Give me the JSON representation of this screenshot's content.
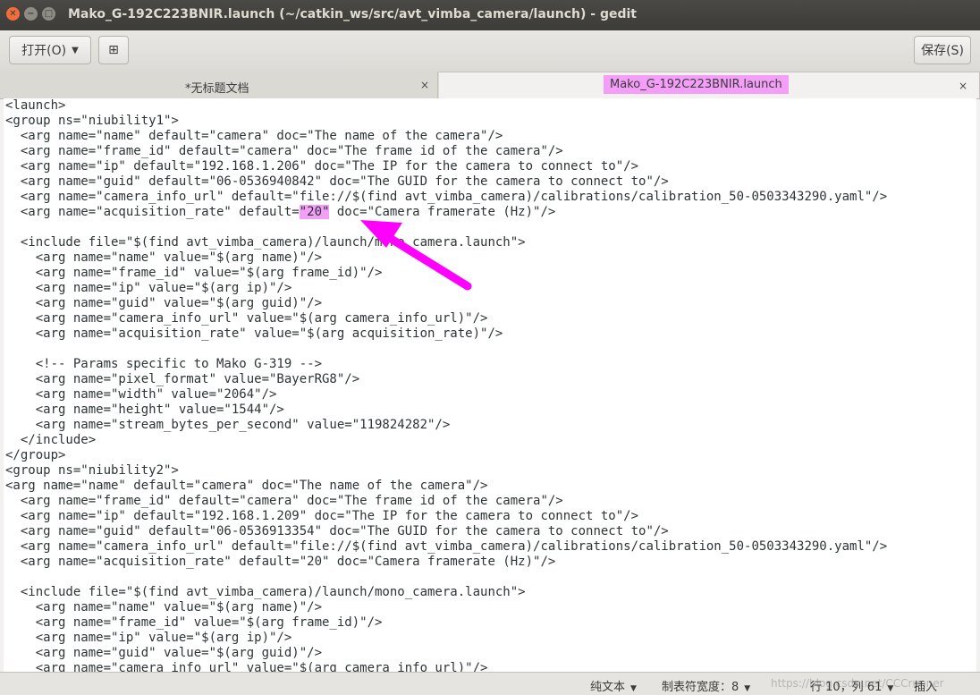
{
  "window": {
    "title": "Mako_G-192C223BNIR.launch (~/catkin_ws/src/avt_vimba_camera/launch) - gedit",
    "close_glyph": "✕",
    "minimize_glyph": "−",
    "maximize_glyph": "□"
  },
  "toolbar": {
    "open_label": "打开(O)",
    "open_arrow": "▼",
    "new_doc_glyph": "⊞",
    "save_label": "保存(S)"
  },
  "tabs": [
    {
      "label": "*无标题文档",
      "close": "×",
      "active": false
    },
    {
      "label": "Mako_G-192C223BNIR.launch",
      "close": "×",
      "active": true
    }
  ],
  "editor": {
    "lines": [
      "<launch>",
      "<group ns=\"niubility1\">",
      "  <arg name=\"name\" default=\"camera\" doc=\"The name of the camera\"/>",
      "  <arg name=\"frame_id\" default=\"camera\" doc=\"The frame id of the camera\"/>",
      "  <arg name=\"ip\" default=\"192.168.1.206\" doc=\"The IP for the camera to connect to\"/>",
      "  <arg name=\"guid\" default=\"06-0536940842\" doc=\"The GUID for the camera to connect to\"/>",
      "  <arg name=\"camera_info_url\" default=\"file://$(find avt_vimba_camera)/calibrations/calibration_50-0503343290.yaml\"/>",
      "  <arg name=\"acquisition_rate\" default=\"20\" doc=\"Camera framerate (Hz)\"/>",
      "",
      "  <include file=\"$(find avt_vimba_camera)/launch/mono_camera.launch\">",
      "    <arg name=\"name\" value=\"$(arg name)\"/>",
      "    <arg name=\"frame_id\" value=\"$(arg frame_id)\"/>",
      "    <arg name=\"ip\" value=\"$(arg ip)\"/>",
      "    <arg name=\"guid\" value=\"$(arg guid)\"/>",
      "    <arg name=\"camera_info_url\" value=\"$(arg camera_info_url)\"/>",
      "    <arg name=\"acquisition_rate\" value=\"$(arg acquisition_rate)\"/>",
      "",
      "    <!-- Params specific to Mako G-319 -->",
      "    <arg name=\"pixel_format\" value=\"BayerRG8\"/>",
      "    <arg name=\"width\" value=\"2064\"/>",
      "    <arg name=\"height\" value=\"1544\"/>",
      "    <arg name=\"stream_bytes_per_second\" value=\"119824282\"/>",
      "  </include>",
      "</group>",
      "<group ns=\"niubility2\">",
      "<arg name=\"name\" default=\"camera\" doc=\"The name of the camera\"/>",
      "  <arg name=\"frame_id\" default=\"camera\" doc=\"The frame id of the camera\"/>",
      "  <arg name=\"ip\" default=\"192.168.1.209\" doc=\"The IP for the camera to connect to\"/>",
      "  <arg name=\"guid\" default=\"06-0536913354\" doc=\"The GUID for the camera to connect to\"/>",
      "  <arg name=\"camera_info_url\" default=\"file://$(find avt_vimba_camera)/calibrations/calibration_50-0503343290.yaml\"/>",
      "  <arg name=\"acquisition_rate\" default=\"20\" doc=\"Camera framerate (Hz)\"/>",
      "",
      "  <include file=\"$(find avt_vimba_camera)/launch/mono_camera.launch\">",
      "    <arg name=\"name\" value=\"$(arg name)\"/>",
      "    <arg name=\"frame_id\" value=\"$(arg frame_id)\"/>",
      "    <arg name=\"ip\" value=\"$(arg ip)\"/>",
      "    <arg name=\"guid\" value=\"$(arg guid)\"/>",
      "    <arg name=\"camera_info_url\" value=\"$(arg camera_info_url)\"/>"
    ],
    "highlight": {
      "line": 7,
      "text": "\"20\""
    },
    "highlight_color": "#f39ef7",
    "arrow_color": "#ff00ff"
  },
  "statusbar": {
    "language": "纯文本",
    "tab_width": "制表符宽度：8",
    "position": "行 10，列 61",
    "mode": "插入",
    "dropdown_glyph": "▼",
    "watermark": "https://blog.csdn.net/CCCrunner"
  }
}
